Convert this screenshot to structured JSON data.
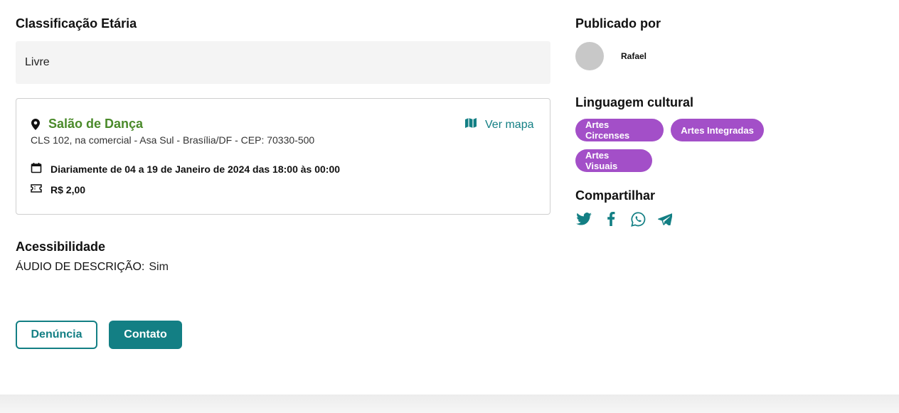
{
  "age_rating": {
    "title": "Classificação Etária",
    "value": "Livre"
  },
  "venue": {
    "name": "Salão de Dança",
    "address": "CLS 102, na comercial - Asa Sul - Brasília/DF - CEP: 70330-500",
    "map_label": "Ver mapa",
    "schedule": "Diariamente de 04 a 19 de Janeiro de 2024 das 18:00 às 00:00",
    "price": "R$ 2,00"
  },
  "accessibility": {
    "title": "Acessibilidade",
    "label": "ÁUDIO DE DESCRIÇÃO:",
    "value": "Sim"
  },
  "actions": {
    "report_label": "Denúncia",
    "contact_label": "Contato"
  },
  "published": {
    "title": "Publicado por",
    "author": "Rafael"
  },
  "cultural": {
    "title": "Linguagem cultural",
    "tags": [
      "Artes Circenses",
      "Artes Integradas",
      "Artes Visuais"
    ]
  },
  "share": {
    "title": "Compartilhar",
    "icons": [
      "twitter-icon",
      "facebook-icon",
      "whatsapp-icon",
      "telegram-icon"
    ]
  },
  "colors": {
    "accent": "#137f84",
    "venue": "#4a8a2a",
    "tag": "#a34fc8"
  }
}
